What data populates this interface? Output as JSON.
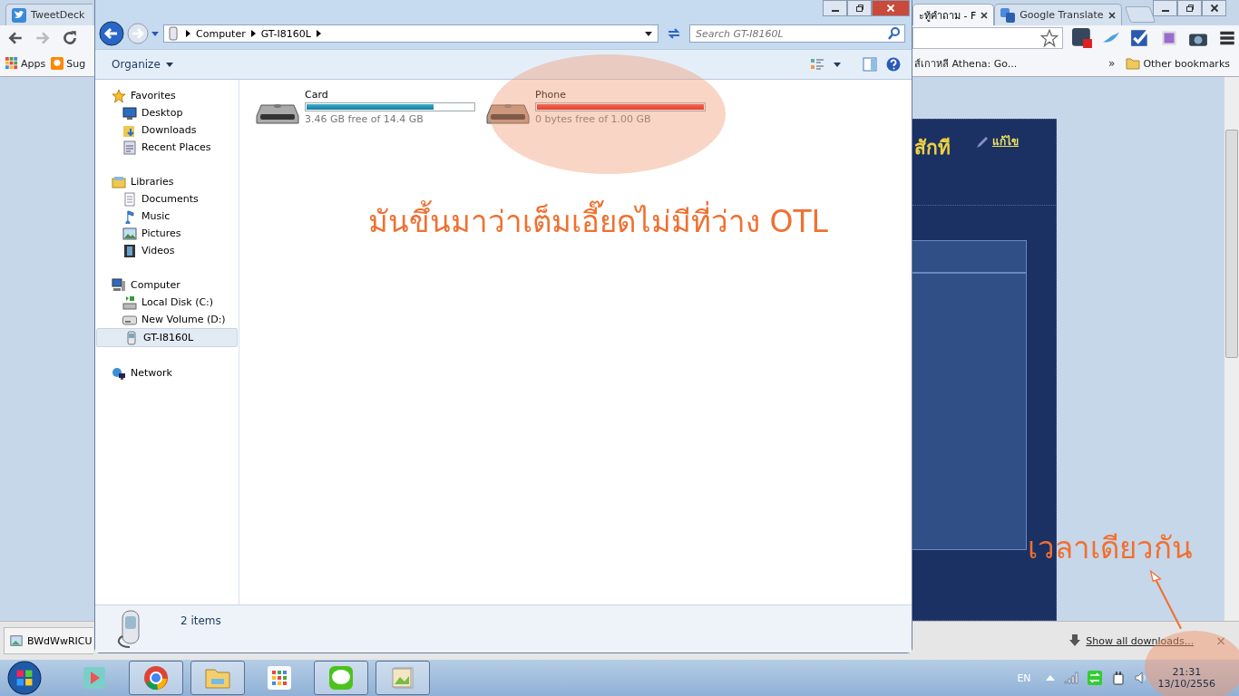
{
  "chrome": {
    "tabs": [
      {
        "title": "TweetDeck",
        "selected": false
      },
      {
        "title": "ะทู้คำถาม - F",
        "selected": true
      },
      {
        "title": "Google Translate",
        "selected": false
      }
    ],
    "bookmarks": [
      {
        "label": "Apps",
        "kind": "apps"
      },
      {
        "label": "Sug",
        "kind": "bulb"
      },
      {
        "label": "ส์เกาหลี Athena: Go..."
      }
    ],
    "more": "»",
    "other_bookmarks": "Other bookmarks",
    "page": {
      "heading": "สักที",
      "edit_link": "แก้ไข"
    },
    "downloads": {
      "items": [
        "BWdWwRICU"
      ],
      "show_all": "Show all downloads...",
      "close": "×"
    }
  },
  "explorer": {
    "breadcrumb": [
      "Computer",
      "GT-I8160L"
    ],
    "search": {
      "placeholder": "Search GT-I8160L"
    },
    "organize": "Organize",
    "nav": [
      {
        "label": "Favorites",
        "kind": "star",
        "selected": false,
        "children": [
          {
            "label": "Desktop",
            "kind": "desktop",
            "selected": false
          },
          {
            "label": "Downloads",
            "kind": "downloads",
            "selected": false
          },
          {
            "label": "Recent Places",
            "kind": "recent",
            "selected": false
          }
        ]
      },
      {
        "label": "Libraries",
        "kind": "library",
        "selected": false,
        "children": [
          {
            "label": "Documents",
            "kind": "document",
            "selected": false
          },
          {
            "label": "Music",
            "kind": "music",
            "selected": false
          },
          {
            "label": "Pictures",
            "kind": "pictures",
            "selected": false
          },
          {
            "label": "Videos",
            "kind": "videos",
            "selected": false
          }
        ]
      },
      {
        "label": "Computer",
        "kind": "computer",
        "selected": false,
        "children": [
          {
            "label": "Local Disk (C:)",
            "kind": "disk",
            "selected": false
          },
          {
            "label": "New Volume (D:)",
            "kind": "drive",
            "selected": false
          },
          {
            "label": "GT-I8160L",
            "kind": "phone",
            "selected": true
          }
        ]
      },
      {
        "label": "Network",
        "kind": "network",
        "selected": false
      }
    ],
    "drives": [
      {
        "name": "Card",
        "level": 0.76,
        "free": "3.46 GB free of 14.4 GB"
      },
      {
        "name": "Phone",
        "level": 1,
        "free": "0 bytes free of 1.00 GB"
      }
    ],
    "status": "2 items"
  },
  "annotations": [
    {
      "text": "มันขึ้นมาว่าเต็มเอี๊ยดไม่มีที่ว่าง OTL"
    },
    {
      "text": "เวลาเดียวกัน"
    }
  ],
  "taskbar": {
    "language": "EN",
    "time": "21:31",
    "date": "13/10/2556"
  }
}
